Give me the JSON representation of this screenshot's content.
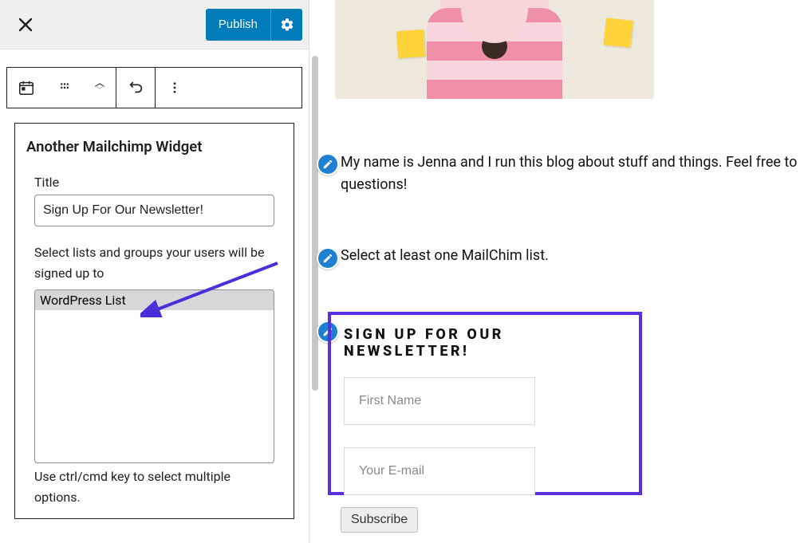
{
  "topbar": {
    "publish_label": "Publish"
  },
  "widget": {
    "panel_title": "Another Mailchimp Widget",
    "title_label": "Title",
    "title_value": "Sign Up For Our Newsletter!",
    "lists_label": "Select lists and groups your users will be signed up to",
    "list_options": [
      "WordPress List"
    ],
    "multiselect_help": "Use ctrl/cmd key to select multiple options."
  },
  "preview": {
    "bio_text": "My name is Jenna and I run this blog about stuff and things. Feel free to questions!",
    "notice_text": "Select at least one MailChim list.",
    "newsletter": {
      "heading": "SIGN UP FOR OUR NEWSLETTER!",
      "first_name_placeholder": "First Name",
      "email_placeholder": "Your E-mail",
      "subscribe_label": "Subscribe"
    }
  },
  "colors": {
    "primary": "#007cba",
    "accent_highlight": "#5a2fe0",
    "sticky": "#ffd43b"
  }
}
